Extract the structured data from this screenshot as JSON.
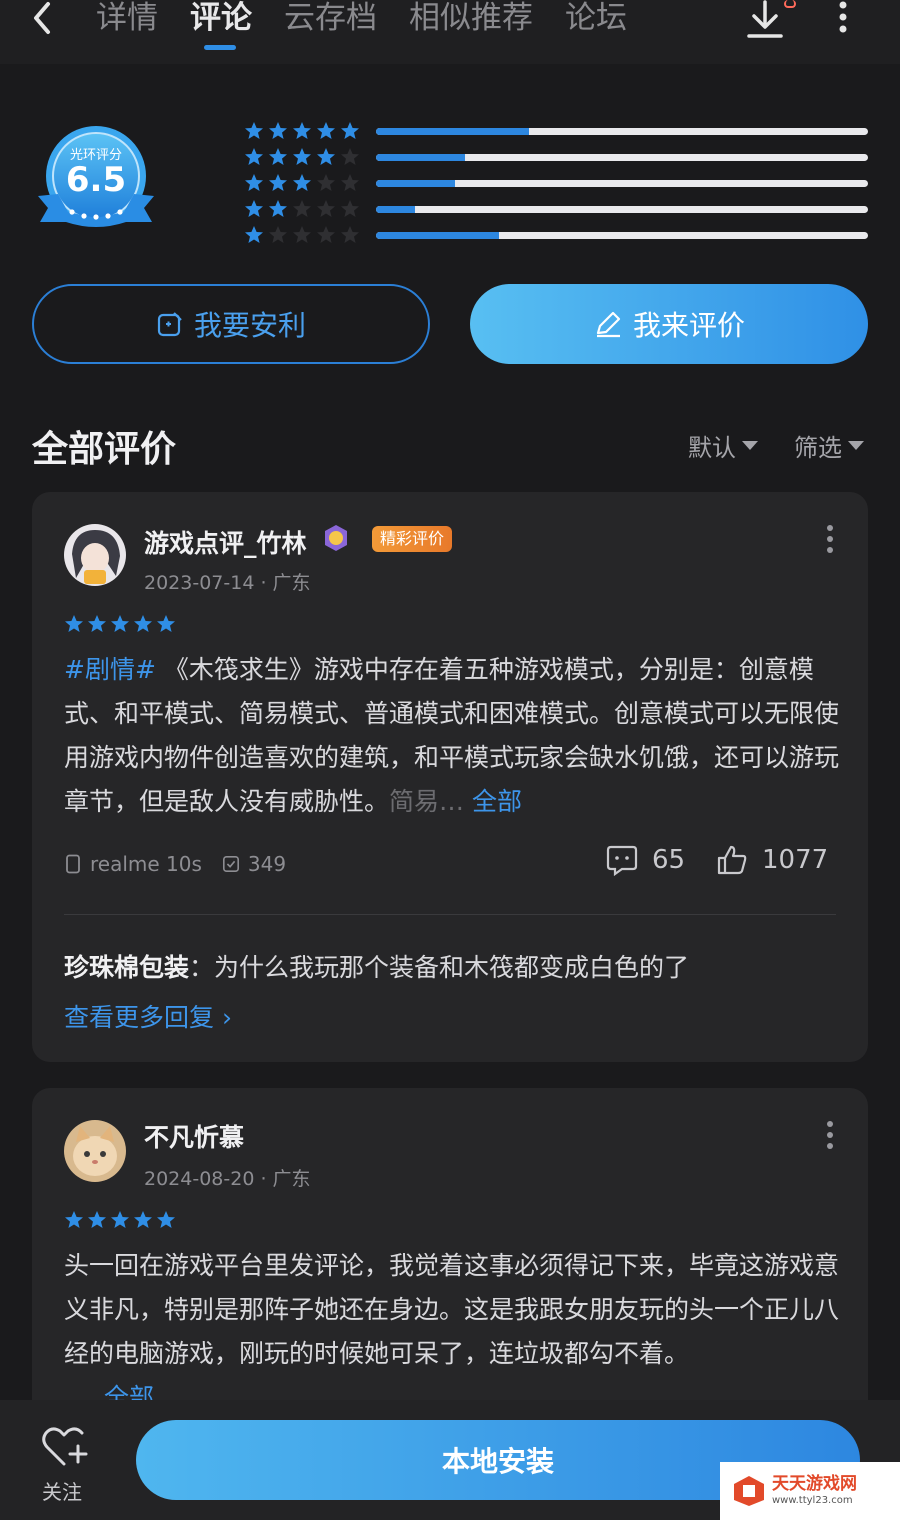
{
  "nav": {
    "tabs": [
      {
        "label": "详情"
      },
      {
        "label": "评论"
      },
      {
        "label": "云存档"
      },
      {
        "label": "相似推荐"
      },
      {
        "label": "论坛"
      }
    ],
    "active_tab": "评论"
  },
  "rating": {
    "badge_label": "光环评分",
    "score": "6.5",
    "distribution": [
      {
        "stars": 5,
        "fraction": 0.31
      },
      {
        "stars": 4,
        "fraction": 0.18
      },
      {
        "stars": 3,
        "fraction": 0.16
      },
      {
        "stars": 2,
        "fraction": 0.08
      },
      {
        "stars": 1,
        "fraction": 0.25
      }
    ],
    "colors": {
      "accent": "#2d87e0",
      "star_on": "#2f8ee6",
      "star_off": "#2f2f32",
      "bar_bg": "#e9e9ec"
    }
  },
  "actions": {
    "recommend_label": "我要安利",
    "review_label": "我来评价"
  },
  "reviews_section": {
    "title": "全部评价",
    "sort_label": "默认",
    "filter_label": "筛选"
  },
  "reviews": [
    {
      "username": "游戏点评_竹林",
      "tag": "精彩评价",
      "date_location": "2023-07-14 · 广东",
      "stars": 5,
      "hashtag": "#剧情#",
      "text_main": "《木筏求生》游戏中存在着五种游戏模式，分别是：创意模式、和平模式、简易模式、普通模式和困难模式。创意模式可以无限使用游戏内物件创造喜欢的建筑，和平模式玩家会缺水饥饿，还可以游玩章节，但是敌人没有威胁性。",
      "text_faded": "简易…",
      "expand_label": "全部",
      "device": "realme 10s",
      "play_count": "349",
      "comment_count": "65",
      "like_count": "1077",
      "reply_user": "珍珠棉包装",
      "reply_text": "为什么我玩那个装备和木筏都变成白色的了",
      "more_replies_label": "查看更多回复 ›"
    },
    {
      "username": "不凡忻慕",
      "date_location": "2024-08-20 · 广东",
      "stars": 5,
      "text_main": "头一回在游戏平台里发评论，我觉着这事必须得记下来，毕竟这游戏意义非凡，特别是那阵子她还在身边。这是我跟女朋友玩的头一个正儿八经的电脑游戏，刚玩的时候她可呆了，连垃圾都勾不着。",
      "expand_label": "全部"
    }
  ],
  "bottom": {
    "follow_label": "关注",
    "install_label": "本地安装"
  },
  "watermark": {
    "title": "天天游戏网",
    "url": "www.ttyl23.com"
  }
}
